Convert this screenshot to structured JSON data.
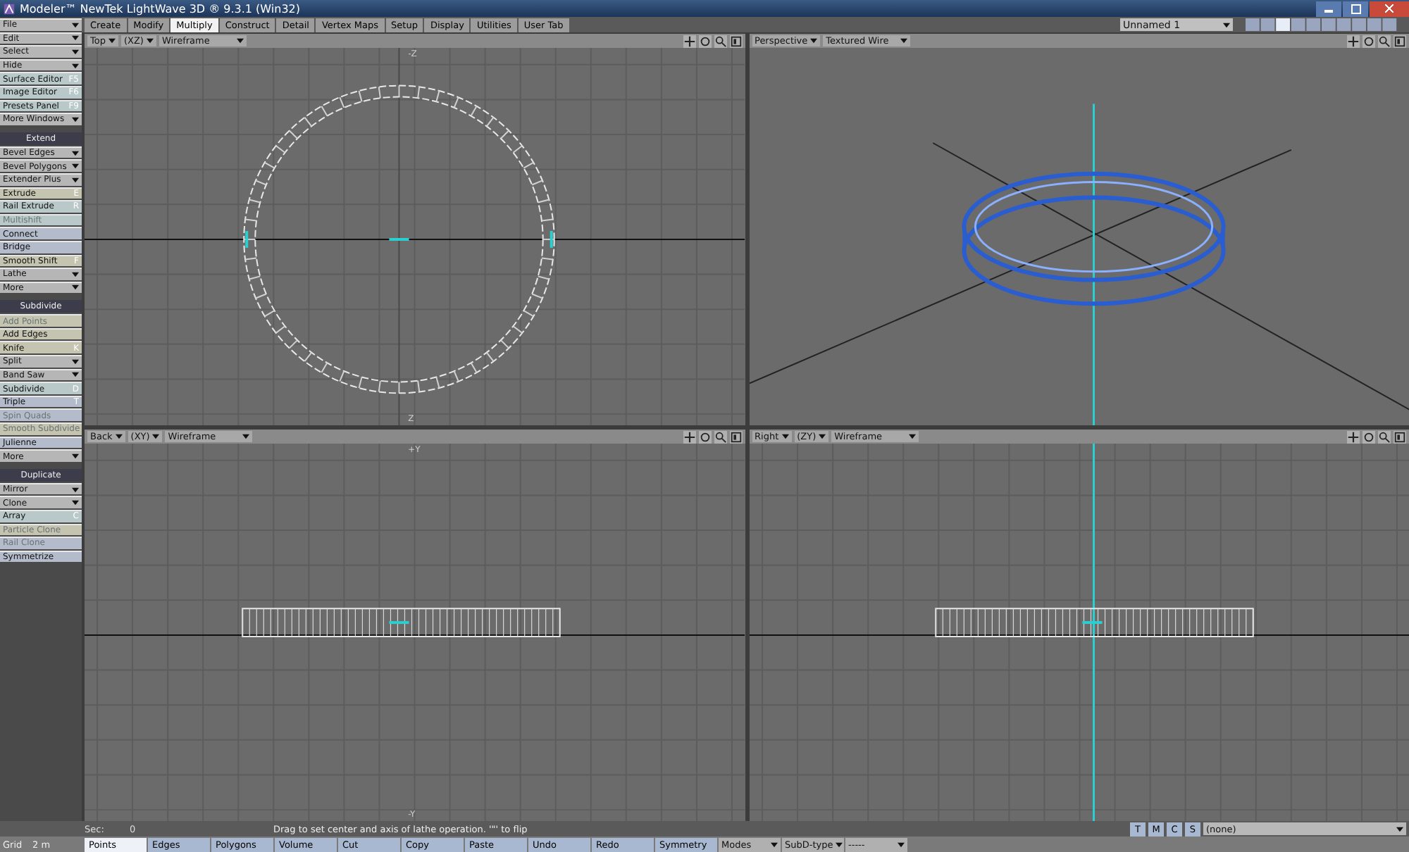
{
  "window": {
    "title": "Modeler™ NewTek LightWave 3D ® 9.3.1 (Win32)"
  },
  "menus": [
    {
      "label": "File"
    },
    {
      "label": "Edit"
    },
    {
      "label": "Select"
    },
    {
      "label": "Hide"
    }
  ],
  "tabs": [
    {
      "label": "Create",
      "selected": false
    },
    {
      "label": "Modify",
      "selected": false
    },
    {
      "label": "Multiply",
      "selected": true
    },
    {
      "label": "Construct",
      "selected": false
    },
    {
      "label": "Detail",
      "selected": false
    },
    {
      "label": "Vertex Maps",
      "selected": false
    },
    {
      "label": "Setup",
      "selected": false
    },
    {
      "label": "Display",
      "selected": false
    },
    {
      "label": "Utilities",
      "selected": false
    },
    {
      "label": "User Tab",
      "selected": false
    }
  ],
  "layer": {
    "value": "Unnamed 1"
  },
  "sidebar": [
    {
      "kind": "button",
      "label": "Surface Editor",
      "shortcut": "F5",
      "color": "#b9c9c9",
      "disabled": false
    },
    {
      "kind": "button",
      "label": "Image Editor",
      "shortcut": "F6",
      "color": "#b9c9c9",
      "disabled": false
    },
    {
      "kind": "button",
      "label": "Presets Panel",
      "shortcut": "F9",
      "color": "#b9c9c9",
      "disabled": false
    },
    {
      "kind": "menu",
      "label": "More Windows"
    },
    {
      "kind": "header",
      "label": "Extend"
    },
    {
      "kind": "menu",
      "label": "Bevel Edges"
    },
    {
      "kind": "menu",
      "label": "Bevel Polygons"
    },
    {
      "kind": "menu",
      "label": "Extender Plus"
    },
    {
      "kind": "button",
      "label": "Extrude",
      "shortcut": "E",
      "color": "#c4c4b0",
      "disabled": false
    },
    {
      "kind": "button",
      "label": "Rail Extrude",
      "shortcut": "R",
      "color": "#b9c9c9",
      "disabled": false
    },
    {
      "kind": "button",
      "label": "Multishift",
      "color": "#b9c9c9",
      "disabled": true
    },
    {
      "kind": "button",
      "label": "Connect",
      "color": "#b4bccc",
      "disabled": false
    },
    {
      "kind": "button",
      "label": "Bridge",
      "color": "#b4bccc",
      "disabled": false
    },
    {
      "kind": "button",
      "label": "Smooth Shift",
      "shortcut": "F",
      "color": "#c4c4b0",
      "disabled": false
    },
    {
      "kind": "menu",
      "label": "Lathe"
    },
    {
      "kind": "menu",
      "label": "More"
    },
    {
      "kind": "header",
      "label": "Subdivide"
    },
    {
      "kind": "button",
      "label": "Add Points",
      "color": "#c4c4b0",
      "disabled": true
    },
    {
      "kind": "button",
      "label": "Add Edges",
      "color": "#c4c4b0",
      "disabled": false
    },
    {
      "kind": "button",
      "label": "Knife",
      "shortcut": "K",
      "color": "#c4c4b0",
      "disabled": false
    },
    {
      "kind": "menu",
      "label": "Split"
    },
    {
      "kind": "menu",
      "label": "Band Saw"
    },
    {
      "kind": "button",
      "label": "Subdivide",
      "shortcut": "D",
      "color": "#b9c9c9",
      "disabled": false
    },
    {
      "kind": "button",
      "label": "Triple",
      "shortcut": "T",
      "color": "#b4bccc",
      "disabled": false
    },
    {
      "kind": "button",
      "label": "Spin Quads",
      "color": "#b4bccc",
      "disabled": true
    },
    {
      "kind": "button",
      "label": "Smooth Subdivide",
      "color": "#c4c4b0",
      "disabled": true
    },
    {
      "kind": "button",
      "label": "Julienne",
      "color": "#b4bccc",
      "disabled": false
    },
    {
      "kind": "menu",
      "label": "More"
    },
    {
      "kind": "header",
      "label": "Duplicate"
    },
    {
      "kind": "menu",
      "label": "Mirror"
    },
    {
      "kind": "menu",
      "label": "Clone"
    },
    {
      "kind": "button",
      "label": "Array",
      "shortcut": "C",
      "color": "#b9c9c9",
      "disabled": false
    },
    {
      "kind": "button",
      "label": "Particle Clone",
      "color": "#c4c4b0",
      "disabled": true
    },
    {
      "kind": "button",
      "label": "Rail Clone",
      "color": "#b4bccc",
      "disabled": true
    },
    {
      "kind": "button",
      "label": "Symmetrize",
      "color": "#b4bccc",
      "disabled": false
    }
  ],
  "viewports": [
    {
      "kind": "top",
      "view": "Top",
      "axes": "(XZ)",
      "mode": "Wireframe",
      "labels": [
        "-Z",
        "Z"
      ]
    },
    {
      "kind": "perspective",
      "view": "Perspective",
      "mode": "Textured Wire"
    },
    {
      "kind": "back",
      "view": "Back",
      "axes": "(XY)",
      "mode": "Wireframe",
      "labels": [
        "+Y",
        "-Y"
      ]
    },
    {
      "kind": "right",
      "view": "Right",
      "axes": "(ZY)",
      "mode": "Wireframe"
    }
  ],
  "status": {
    "grid_label": "Sec:",
    "grid_value": "0",
    "message": "Drag to set center and axis of lathe operation. '\"' to flip",
    "modes": [
      "T",
      "M",
      "C",
      "S"
    ],
    "dropdown": "(none)"
  },
  "bottom": {
    "grid": "Grid",
    "grid_value": "2 m",
    "buttons": [
      {
        "label": "Points",
        "selected": true
      },
      {
        "label": "Edges",
        "selected": false
      },
      {
        "label": "Polygons",
        "selected": false
      },
      {
        "label": "Volume",
        "selected": false
      },
      {
        "label": "Cut",
        "selected": false
      },
      {
        "label": "Copy",
        "selected": false
      },
      {
        "label": "Paste",
        "selected": false
      },
      {
        "label": "Undo",
        "selected": false
      },
      {
        "label": "Redo",
        "selected": false
      },
      {
        "label": "Symmetry",
        "selected": false
      }
    ],
    "dropdowns": [
      "Modes",
      "SubD-type",
      "-----"
    ]
  }
}
